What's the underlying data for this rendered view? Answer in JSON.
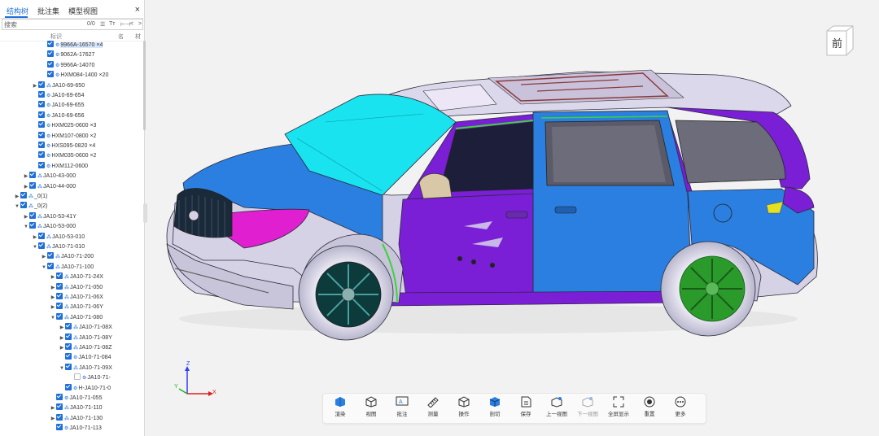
{
  "panel": {
    "tabs": [
      {
        "label": "结构树",
        "active": true
      },
      {
        "label": "批注集",
        "active": false
      },
      {
        "label": "模型视图",
        "active": false
      }
    ],
    "close_icon": "×",
    "search": {
      "placeholder": "搜索",
      "count": "0/0"
    },
    "columns": [
      "标识",
      "名",
      "材"
    ],
    "tree": [
      {
        "label": "9966A-16570 ×4",
        "level": 4,
        "arrow": "",
        "checked": true,
        "selected": true,
        "icon": "part"
      },
      {
        "label": "9062A-17627",
        "level": 4,
        "arrow": "",
        "checked": true,
        "icon": "part"
      },
      {
        "label": "9966A-14070",
        "level": 4,
        "arrow": "",
        "checked": true,
        "icon": "part"
      },
      {
        "label": "HXM084-1400 ×20",
        "level": 4,
        "arrow": "",
        "checked": true,
        "icon": "part"
      },
      {
        "label": "JA10-69-650",
        "level": 3,
        "arrow": "▶",
        "checked": true,
        "icon": "asm"
      },
      {
        "label": "JA10-69-654",
        "level": 3,
        "arrow": "",
        "checked": true,
        "icon": "part"
      },
      {
        "label": "JA10-69-655",
        "level": 3,
        "arrow": "",
        "checked": true,
        "icon": "part"
      },
      {
        "label": "JA10-69-656",
        "level": 3,
        "arrow": "",
        "checked": true,
        "icon": "part"
      },
      {
        "label": "HXM025-0600 ×3",
        "level": 3,
        "arrow": "",
        "checked": true,
        "icon": "part"
      },
      {
        "label": "HXM107-0800 ×2",
        "level": 3,
        "arrow": "",
        "checked": true,
        "icon": "part"
      },
      {
        "label": "HXS095-0820 ×4",
        "level": 3,
        "arrow": "",
        "checked": true,
        "icon": "part"
      },
      {
        "label": "HXM035-0600 ×2",
        "level": 3,
        "arrow": "",
        "checked": true,
        "icon": "part"
      },
      {
        "label": "HXM112-0600",
        "level": 3,
        "arrow": "",
        "checked": true,
        "icon": "part"
      },
      {
        "label": "JA10-43-000",
        "level": 2,
        "arrow": "▶",
        "checked": true,
        "icon": "asm"
      },
      {
        "label": "JA10-44-000",
        "level": 2,
        "arrow": "▶",
        "checked": true,
        "icon": "asm"
      },
      {
        "label": "_0(1)",
        "level": 1,
        "arrow": "▶",
        "checked": true,
        "icon": "asm"
      },
      {
        "label": "_0(2)",
        "level": 1,
        "arrow": "▼",
        "checked": true,
        "icon": "asm"
      },
      {
        "label": "JA10-53-41Y",
        "level": 2,
        "arrow": "▶",
        "checked": true,
        "icon": "asm"
      },
      {
        "label": "JA10-53-000",
        "level": 2,
        "arrow": "▼",
        "checked": true,
        "icon": "asm"
      },
      {
        "label": "JA10-53-010",
        "level": 3,
        "arrow": "▶",
        "checked": true,
        "icon": "asm"
      },
      {
        "label": "JA10-71-010",
        "level": 3,
        "arrow": "▼",
        "checked": true,
        "icon": "asm"
      },
      {
        "label": "JA10-71-200",
        "level": 4,
        "arrow": "▶",
        "checked": true,
        "icon": "asm"
      },
      {
        "label": "JA10-71-100",
        "level": 4,
        "arrow": "▼",
        "checked": true,
        "icon": "asm"
      },
      {
        "label": "JA10-71-24X",
        "level": 5,
        "arrow": "▶",
        "checked": true,
        "icon": "asm"
      },
      {
        "label": "JA10-71-050",
        "level": 5,
        "arrow": "▶",
        "checked": true,
        "icon": "asm"
      },
      {
        "label": "JA10-71-06X",
        "level": 5,
        "arrow": "▶",
        "checked": true,
        "icon": "asm"
      },
      {
        "label": "JA10-71-06Y",
        "level": 5,
        "arrow": "▶",
        "checked": true,
        "icon": "asm"
      },
      {
        "label": "JA10-71-080",
        "level": 5,
        "arrow": "▼",
        "checked": true,
        "icon": "asm"
      },
      {
        "label": "JA10-71-08X",
        "level": 6,
        "arrow": "▶",
        "checked": true,
        "icon": "asm"
      },
      {
        "label": "JA10-71-08Y",
        "level": 6,
        "arrow": "▶",
        "checked": true,
        "icon": "asm"
      },
      {
        "label": "JA10-71-08Z",
        "level": 6,
        "arrow": "▶",
        "checked": true,
        "icon": "asm"
      },
      {
        "label": "JA10-71-084",
        "level": 6,
        "arrow": "",
        "checked": true,
        "icon": "part"
      },
      {
        "label": "JA10-71-09X",
        "level": 6,
        "arrow": "▼",
        "checked": true,
        "icon": "asm"
      },
      {
        "label": "JA10-71-",
        "level": 7,
        "arrow": "",
        "checked": false,
        "icon": "part"
      },
      {
        "label": "H-JA10-71-0",
        "level": 6,
        "arrow": "",
        "checked": true,
        "icon": "part"
      },
      {
        "label": "JA10-71-055",
        "level": 5,
        "arrow": "",
        "checked": true,
        "icon": "part"
      },
      {
        "label": "JA10-71-110",
        "level": 5,
        "arrow": "▶",
        "checked": true,
        "icon": "asm"
      },
      {
        "label": "JA10-71-130",
        "level": 5,
        "arrow": "▶",
        "checked": true,
        "icon": "asm"
      },
      {
        "label": "JA10-71-113",
        "level": 5,
        "arrow": "",
        "checked": true,
        "icon": "part"
      }
    ]
  },
  "view_cube": {
    "face": "前"
  },
  "axes": {
    "x": "X",
    "y": "Y",
    "z": "Z"
  },
  "toolbar": [
    {
      "label": "渲染",
      "icon": "render-icon"
    },
    {
      "label": "视图",
      "icon": "view-icon"
    },
    {
      "label": "批注",
      "icon": "annotation-icon"
    },
    {
      "label": "测量",
      "icon": "measure-icon"
    },
    {
      "label": "操作",
      "icon": "operate-icon"
    },
    {
      "label": "剖切",
      "icon": "section-icon"
    },
    {
      "label": "保存",
      "icon": "save-icon"
    },
    {
      "label": "上一视图",
      "icon": "prev-view-icon"
    },
    {
      "label": "下一视图",
      "icon": "next-view-icon",
      "disabled": true
    },
    {
      "label": "全屏显示",
      "icon": "fullscreen-icon"
    },
    {
      "label": "重置",
      "icon": "reset-icon"
    },
    {
      "label": "更多",
      "icon": "more-icon"
    }
  ],
  "colors": {
    "accent": "#1f6fd8",
    "body_purple": "#7a1fd6",
    "body_blue": "#2a7fe0",
    "glass_cyan": "#19e3ef",
    "accent_magenta": "#e01fd0",
    "wheel_green": "#2a9a2a"
  }
}
